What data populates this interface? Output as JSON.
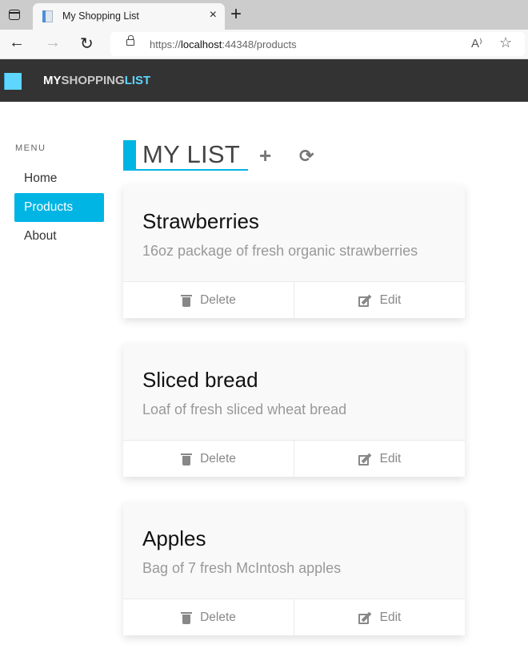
{
  "browser": {
    "tab_title": "My Shopping List",
    "tab_close": "×",
    "new_tab": "+",
    "url_prefix": "https://",
    "url_host": "localhost",
    "url_rest": ":44348/products",
    "icons": {
      "back": "←",
      "forward": "→",
      "reload": "↻",
      "read_aloud": "A⁾",
      "favorites": "☆"
    }
  },
  "header": {
    "brand_my": "MY",
    "brand_shopping": "SHOPPING",
    "brand_list": "LIST",
    "accent_color": "#5ed6ff",
    "background_color": "#333333"
  },
  "sidebar": {
    "menu_label": "MENU",
    "items": [
      {
        "label": "Home",
        "active": false
      },
      {
        "label": "Products",
        "active": true
      },
      {
        "label": "About",
        "active": false
      }
    ],
    "active_color": "#00b4e4"
  },
  "main": {
    "title": "MY LIST",
    "add_icon": "+",
    "refresh_icon": "⟳",
    "products": [
      {
        "name": "Strawberries",
        "description": "16oz package of fresh organic strawberries",
        "delete_label": "Delete",
        "edit_label": "Edit"
      },
      {
        "name": "Sliced bread",
        "description": "Loaf of fresh sliced wheat bread",
        "delete_label": "Delete",
        "edit_label": "Edit"
      },
      {
        "name": "Apples",
        "description": "Bag of 7 fresh McIntosh apples",
        "delete_label": "Delete",
        "edit_label": "Edit"
      }
    ]
  }
}
